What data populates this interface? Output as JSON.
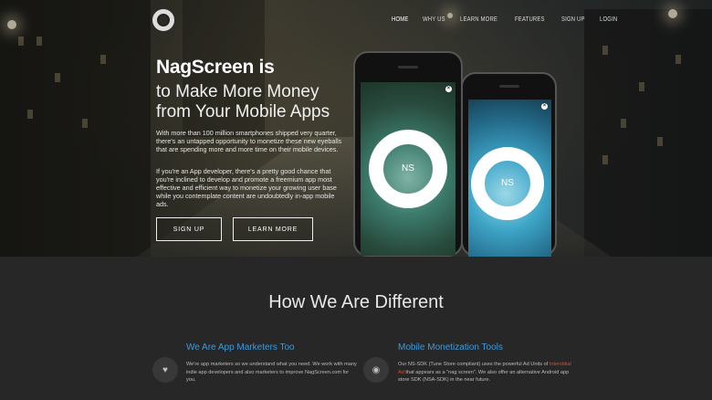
{
  "nav": {
    "items": [
      {
        "label": "HOME",
        "active": true
      },
      {
        "label": "WHY US",
        "active": false
      },
      {
        "label": "LEARN MORE",
        "active": false
      },
      {
        "label": "FEATURES",
        "active": false
      },
      {
        "label": "SIGN UP",
        "active": false
      },
      {
        "label": "LOGIN",
        "active": false
      }
    ]
  },
  "hero": {
    "title_brand": "NagScreen is",
    "title_rest": "to Make More Money from Your Mobile Apps",
    "paragraph1": "With more than 100 million smartphones shipped very quarter, there's an untapped opportunity to monetize these new eyeballs that are spending more and more time on their mobile devices.",
    "paragraph2": "If you're an App developer, there's a pretty good chance that you're inclined to develop and promote a freemium app most effective and efficient way to monetize your growing user base while you contemplate content are undoubtedly in-app mobile ads.",
    "signup_label": "SIGN UP",
    "learn_label": "LEARN MORE",
    "phone_badge": "NS",
    "close_glyph": "×"
  },
  "section": {
    "heading": "How We Are Different",
    "features": [
      {
        "title": "We Are App Marketers Too",
        "icon": "heart-icon",
        "text": "We're app marketers so we understand what you need. We work with many indie app developers and also marketers to improve NagScreen.com for you."
      },
      {
        "title": "Mobile Monetization Tools",
        "icon": "eye-icon",
        "text_before": "Our NS-SDK (Tune Store compliant) uses the powerful Ad Units of ",
        "text_red": "Interstitial Ad",
        "text_after": " that appears as a \"nag screen\". We also offer an alternative Android app store SDK (NSA-SDK) in the near future."
      }
    ]
  },
  "colors": {
    "accent_blue": "#3e9ad9",
    "accent_red": "#d44b3c",
    "dark_bg": "#272727"
  }
}
